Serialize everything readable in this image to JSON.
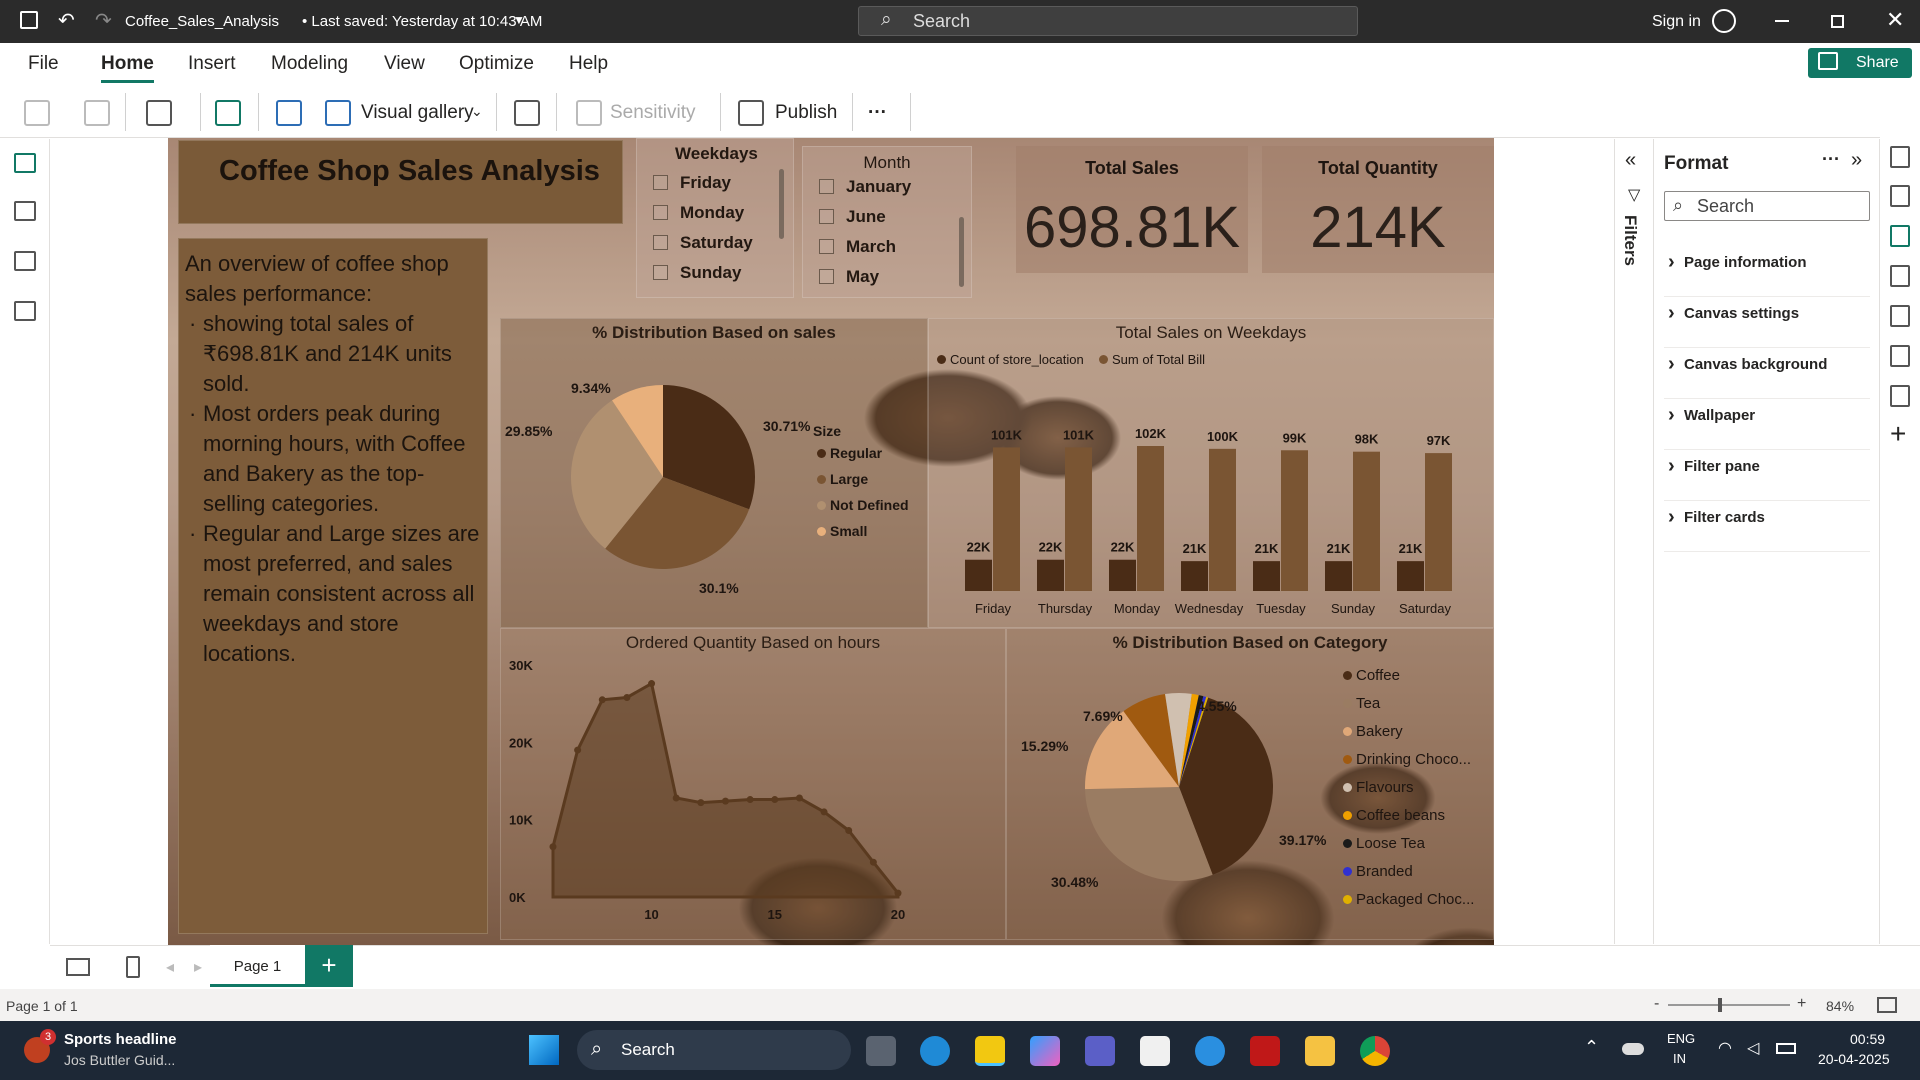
{
  "titlebar": {
    "filename": "Coffee_Sales_Analysis",
    "saved": "• Last saved: Yesterday at 10:43 AM",
    "search": "Search",
    "signin": "Sign in"
  },
  "menu": {
    "file": "File",
    "home": "Home",
    "insert": "Insert",
    "modeling": "Modeling",
    "view": "View",
    "optimize": "Optimize",
    "help": "Help",
    "share": "Share"
  },
  "ribbon": {
    "visual_gallery": "Visual gallery",
    "sensitivity": "Sensitivity",
    "publish": "Publish",
    "more": "···"
  },
  "report": {
    "title": "Coffee Shop Sales Analysis",
    "overview_intro": "An overview of coffee shop sales performance:",
    "bullets": [
      "showing total sales of ₹698.81K and 214K units sold.",
      "Most orders peak during morning hours, with Coffee and Bakery as the top-selling categories.",
      "Regular and Large sizes are most preferred, and sales remain consistent across all weekdays and store locations."
    ],
    "weekdays_slicer": {
      "title": "Weekdays",
      "items": [
        "Friday",
        "Monday",
        "Saturday",
        "Sunday"
      ]
    },
    "month_slicer": {
      "title": "Month",
      "items": [
        "January",
        "June",
        "March",
        "May"
      ]
    },
    "total_sales": {
      "label": "Total Sales",
      "value": "698.81K"
    },
    "total_quantity": {
      "label": "Total Quantity",
      "value": "214K"
    }
  },
  "chart_data": [
    {
      "type": "pie",
      "title": "% Distribution Based on sales",
      "legend_title": "Size",
      "labels": [
        "Regular",
        "Large",
        "Not Defined",
        "Small"
      ],
      "values": [
        30.71,
        30.1,
        29.85,
        9.34
      ],
      "value_labels": [
        "30.71%",
        "30.1%",
        "29.85%",
        "9.34%"
      ],
      "colors": [
        "#4a2c16",
        "#7a5533",
        "#b09070",
        "#e8b07c"
      ]
    },
    {
      "type": "bar",
      "title": "Total Sales on Weekdays",
      "categories": [
        "Friday",
        "Thursday",
        "Monday",
        "Wednesday",
        "Tuesday",
        "Sunday",
        "Saturday"
      ],
      "series": [
        {
          "name": "Count of store_location",
          "values": [
            22,
            22,
            22,
            21,
            21,
            21,
            21
          ],
          "labels": [
            "22K",
            "22K",
            "22K",
            "21K",
            "21K",
            "21K",
            "21K"
          ],
          "color": "#4a2c16"
        },
        {
          "name": "Sum of Total Bill",
          "values": [
            101,
            101,
            102,
            100,
            99,
            98,
            97
          ],
          "labels": [
            "101K",
            "101K",
            "102K",
            "100K",
            "99K",
            "98K",
            "97K"
          ],
          "color": "#7a5533"
        }
      ]
    },
    {
      "type": "area",
      "title": "Ordered Quantity Based on hours",
      "x": [
        6,
        7,
        8,
        9,
        10,
        11,
        12,
        13,
        14,
        15,
        16,
        17,
        18,
        19,
        20
      ],
      "y": [
        6500,
        19000,
        25500,
        25800,
        27600,
        12800,
        12200,
        12400,
        12600,
        12600,
        12800,
        11000,
        8600,
        4500,
        500
      ],
      "yticks": [
        "0K",
        "10K",
        "20K",
        "30K"
      ],
      "xticks": [
        "10",
        "15",
        "20"
      ],
      "ylim": [
        0,
        30000
      ],
      "color": "#5a3a1f"
    },
    {
      "type": "pie",
      "title": "% Distribution Based on Category",
      "labels": [
        "Coffee",
        "Tea",
        "Bakery",
        "Drinking Choco...",
        "Flavours",
        "Coffee beans",
        "Loose Tea",
        "Branded",
        "Packaged Choc..."
      ],
      "values": [
        39.17,
        30.48,
        15.29,
        7.69,
        4.55,
        1.2,
        0.8,
        0.5,
        0.32
      ],
      "value_labels": [
        "39.17%",
        "30.48%",
        "15.29%",
        "7.69%",
        "4.55%"
      ],
      "colors": [
        "#4a2c16",
        "#9a7c62",
        "#e0a878",
        "#a05a10",
        "#d0c0b0",
        "#f0a000",
        "#1a1a1a",
        "#3030d0",
        "#e0b000"
      ]
    }
  ],
  "filters": {
    "label": "Filters"
  },
  "format": {
    "title": "Format",
    "search": "Search",
    "sections": [
      "Page information",
      "Canvas settings",
      "Canvas background",
      "Wallpaper",
      "Filter pane",
      "Filter cards"
    ]
  },
  "pages": {
    "tab": "Page 1",
    "add": "+"
  },
  "status": {
    "page": "Page 1 of 1",
    "zoom": "84%"
  },
  "taskbar": {
    "news_title": "Sports headline",
    "news_sub": "Jos Buttler Guid...",
    "badge": "3",
    "search": "Search",
    "lang1": "ENG",
    "lang2": "IN",
    "time": "00:59",
    "date": "20-04-2025"
  }
}
